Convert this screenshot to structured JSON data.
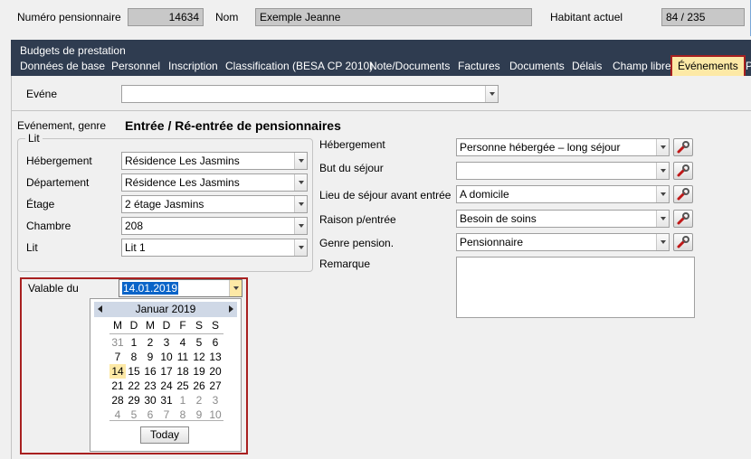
{
  "header": {
    "pensioner_number_label": "Numéro pensionnaire",
    "pensioner_number": "14634",
    "name_label": "Nom",
    "name": "Exemple Jeanne",
    "current_resident_label": "Habitant actuel",
    "current_resident": "84 / 235"
  },
  "nav": {
    "title": "Budgets de prestation",
    "tabs": [
      "Données de base",
      "Personnel",
      "Inscription",
      "Classification (BESA CP 2010)",
      "Note/Documents",
      "Factures",
      "Documents",
      "Délais",
      "Champ libre",
      "Événements",
      "P"
    ]
  },
  "event": {
    "label": "Evéne",
    "value": ""
  },
  "genre": {
    "label": "Evénement, genre",
    "title": "Entrée / Ré-entrée de pensionnaires"
  },
  "lit_group": {
    "legend": "Lit",
    "fields": [
      {
        "label": "Hébergement",
        "value": "Résidence Les Jasmins"
      },
      {
        "label": "Département",
        "value": "Résidence Les Jasmins"
      },
      {
        "label": "Étage",
        "value": "2 étage Jasmins"
      },
      {
        "label": "Chambre",
        "value": "208"
      },
      {
        "label": "Lit",
        "value": "Lit 1"
      }
    ]
  },
  "right_fields": [
    {
      "label": "Hébergement",
      "value": "Personne hébergée – long séjour"
    },
    {
      "label": "But du séjour",
      "value": ""
    },
    {
      "label": "Lieu de séjour avant entrée",
      "value": "A domicile"
    },
    {
      "label": "Raison p/entrée",
      "value": "Besoin de soins"
    },
    {
      "label": "Genre pension.",
      "value": "Pensionnaire"
    }
  ],
  "remark": {
    "label": "Remarque",
    "value": ""
  },
  "valid_from": {
    "label": "Valable du",
    "value": "14.01.2019"
  },
  "calendar": {
    "month": "Januar 2019",
    "weekdays": [
      "M",
      "D",
      "M",
      "D",
      "F",
      "S",
      "S"
    ],
    "weeks": [
      [
        "31",
        "1",
        "2",
        "3",
        "4",
        "5",
        "6"
      ],
      [
        "7",
        "8",
        "9",
        "10",
        "11",
        "12",
        "13"
      ],
      [
        "14",
        "15",
        "16",
        "17",
        "18",
        "19",
        "20"
      ],
      [
        "21",
        "22",
        "23",
        "24",
        "25",
        "26",
        "27"
      ],
      [
        "28",
        "29",
        "30",
        "31",
        "1",
        "2",
        "3"
      ],
      [
        "4",
        "5",
        "6",
        "7",
        "8",
        "9",
        "10"
      ]
    ],
    "selected_day": "14",
    "today_label": "Today"
  },
  "colors": {
    "nav_background": "#2f3c50",
    "active_tab_background": "#fde9a6",
    "highlight_border": "#a82020",
    "selection": "#0a64c8"
  }
}
